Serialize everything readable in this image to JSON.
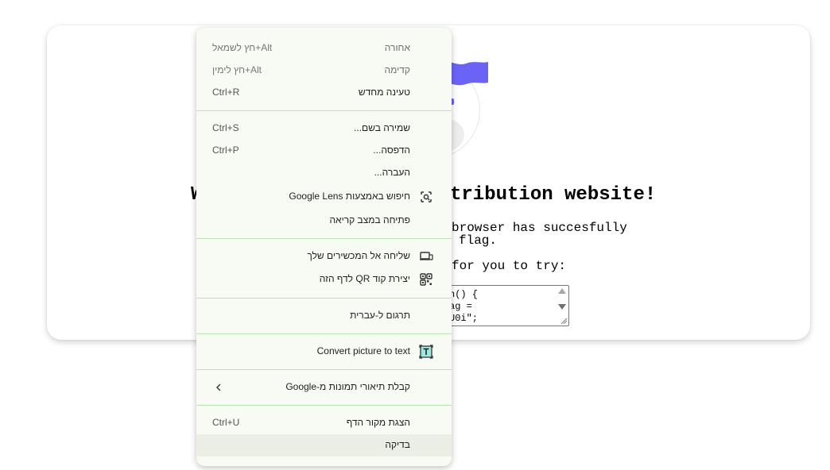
{
  "page": {
    "heading_left": "W",
    "heading_right": "tribution website!",
    "line1": "browser has succesfully",
    "line2": "flag.",
    "line3": "for you to try:",
    "code_lines": [
      "n() {",
      "ag =",
      "U0i\";"
    ]
  },
  "colors": {
    "menu_bg": "#f8fbf3",
    "separator": "#b9e6b0",
    "flag": "#6b63f5"
  },
  "menu": {
    "items": [
      {
        "label": "אחורה",
        "accel": "חץ לשמאל+Alt",
        "disabled": true
      },
      {
        "label": "קדימה",
        "accel": "חץ לימין+Alt",
        "disabled": true
      },
      {
        "label": "טעינה מחדש",
        "accel": "Ctrl+R"
      },
      {
        "label": "שמירה בשם...",
        "accel": "Ctrl+S"
      },
      {
        "label": "הדפסה...",
        "accel": "Ctrl+P"
      },
      {
        "label": "העברה...",
        "accel": ""
      },
      {
        "label": "חיפוש באמצעות Google Lens",
        "icon": "google-lens-icon"
      },
      {
        "label": "פתיחה במצב קריאה"
      },
      {
        "label": "שליחה אל המכשירים שלך",
        "icon": "devices-icon"
      },
      {
        "label": "יצירת קוד QR לדף הזה",
        "icon": "qr-code-icon"
      },
      {
        "label": "תרגום ל-עברית"
      },
      {
        "label": "Convert picture to text",
        "icon": "text-recognition-icon"
      },
      {
        "label": "קבלת תיאורי תמונות מ-Google",
        "submenu": true
      },
      {
        "label": "הצגת מקור הדף",
        "accel": "Ctrl+U"
      },
      {
        "label": "בדיקה",
        "highlighted": true
      }
    ]
  }
}
